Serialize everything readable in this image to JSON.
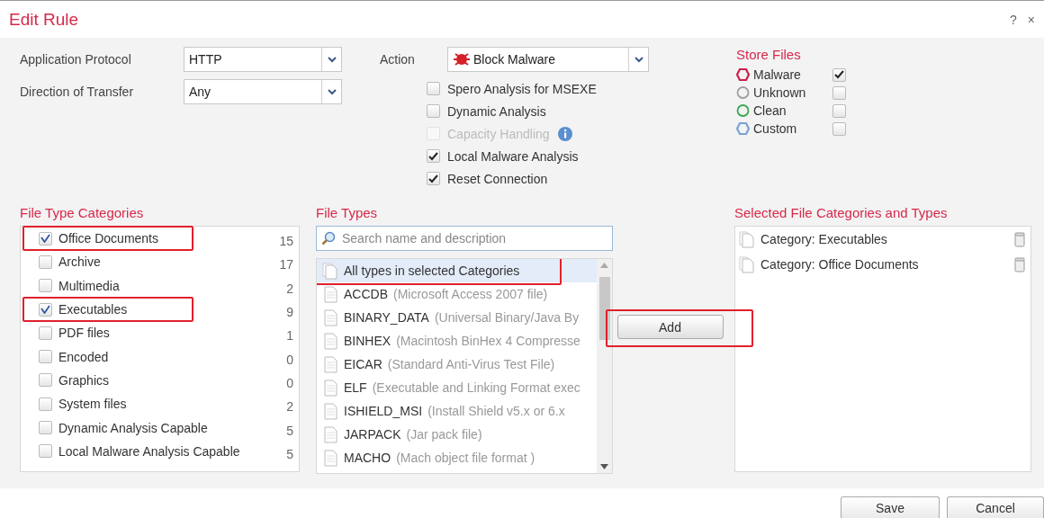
{
  "window": {
    "title": "Edit Rule",
    "help": "?",
    "close": "×"
  },
  "protocol": {
    "label": "Application Protocol",
    "value": "HTTP"
  },
  "direction": {
    "label": "Direction of Transfer",
    "value": "Any"
  },
  "action": {
    "label": "Action",
    "value": "Block Malware"
  },
  "options": [
    {
      "label": "Spero Analysis for MSEXE",
      "checked": false,
      "disabled": false,
      "info": false
    },
    {
      "label": "Dynamic Analysis",
      "checked": false,
      "disabled": false,
      "info": false
    },
    {
      "label": "Capacity Handling",
      "checked": false,
      "disabled": true,
      "info": true
    },
    {
      "label": "Local Malware Analysis",
      "checked": true,
      "disabled": false,
      "info": false
    },
    {
      "label": "Reset Connection",
      "checked": true,
      "disabled": false,
      "info": false
    }
  ],
  "store_files": {
    "title": "Store Files",
    "items": [
      {
        "label": "Malware",
        "kind": "hexagon",
        "color": "#cc1f4a",
        "checked": true
      },
      {
        "label": "Unknown",
        "kind": "circle",
        "color": "#a0a0a0",
        "checked": false
      },
      {
        "label": "Clean",
        "kind": "circle",
        "color": "#3aa84f",
        "checked": false
      },
      {
        "label": "Custom",
        "kind": "hexagon",
        "color": "#7aa2d8",
        "checked": false
      }
    ]
  },
  "categories": {
    "title": "File Type Categories",
    "items": [
      {
        "label": "Office Documents",
        "count": "15",
        "checked": true,
        "highlighted": true
      },
      {
        "label": "Archive",
        "count": "17",
        "checked": false,
        "highlighted": false
      },
      {
        "label": "Multimedia",
        "count": "2",
        "checked": false,
        "highlighted": false
      },
      {
        "label": "Executables",
        "count": "9",
        "checked": true,
        "highlighted": true
      },
      {
        "label": "PDF files",
        "count": "1",
        "checked": false,
        "highlighted": false
      },
      {
        "label": "Encoded",
        "count": "0",
        "checked": false,
        "highlighted": false
      },
      {
        "label": "Graphics",
        "count": "0",
        "checked": false,
        "highlighted": false
      },
      {
        "label": "System files",
        "count": "2",
        "checked": false,
        "highlighted": false
      },
      {
        "label": "Dynamic Analysis Capable",
        "count": "5",
        "checked": false,
        "highlighted": false
      },
      {
        "label": "Local Malware Analysis Capable",
        "count": "5",
        "checked": false,
        "highlighted": false
      }
    ]
  },
  "file_types": {
    "title": "File Types",
    "search_placeholder": "Search name and description",
    "items": [
      {
        "name": "All types in selected Categories",
        "selected": true,
        "highlighted": true
      },
      {
        "name": "ACCDB",
        "description": "(Microsoft Access 2007 file)",
        "selected": false,
        "highlighted": false
      },
      {
        "name": "BINARY_DATA",
        "description": "(Universal Binary/Java By",
        "selected": false,
        "highlighted": false
      },
      {
        "name": "BINHEX",
        "description": "(Macintosh BinHex 4 Compresse",
        "selected": false,
        "highlighted": false
      },
      {
        "name": "EICAR",
        "description": "(Standard Anti-Virus Test File)",
        "selected": false,
        "highlighted": false
      },
      {
        "name": "ELF",
        "description": "(Executable and Linking Format exec",
        "selected": false,
        "highlighted": false
      },
      {
        "name": "ISHIELD_MSI",
        "description": "(Install Shield v5.x or 6.x",
        "selected": false,
        "highlighted": false
      },
      {
        "name": "JARPACK",
        "description": "(Jar pack file)",
        "selected": false,
        "highlighted": false
      },
      {
        "name": "MACHO",
        "description": "(Mach object file format )",
        "selected": false,
        "highlighted": false
      }
    ]
  },
  "add_button": {
    "label": "Add",
    "highlighted": true
  },
  "selected": {
    "title": "Selected File Categories and Types",
    "items": [
      "Category: Executables",
      "Category: Office Documents"
    ]
  },
  "buttons": [
    "Save",
    "Cancel"
  ]
}
